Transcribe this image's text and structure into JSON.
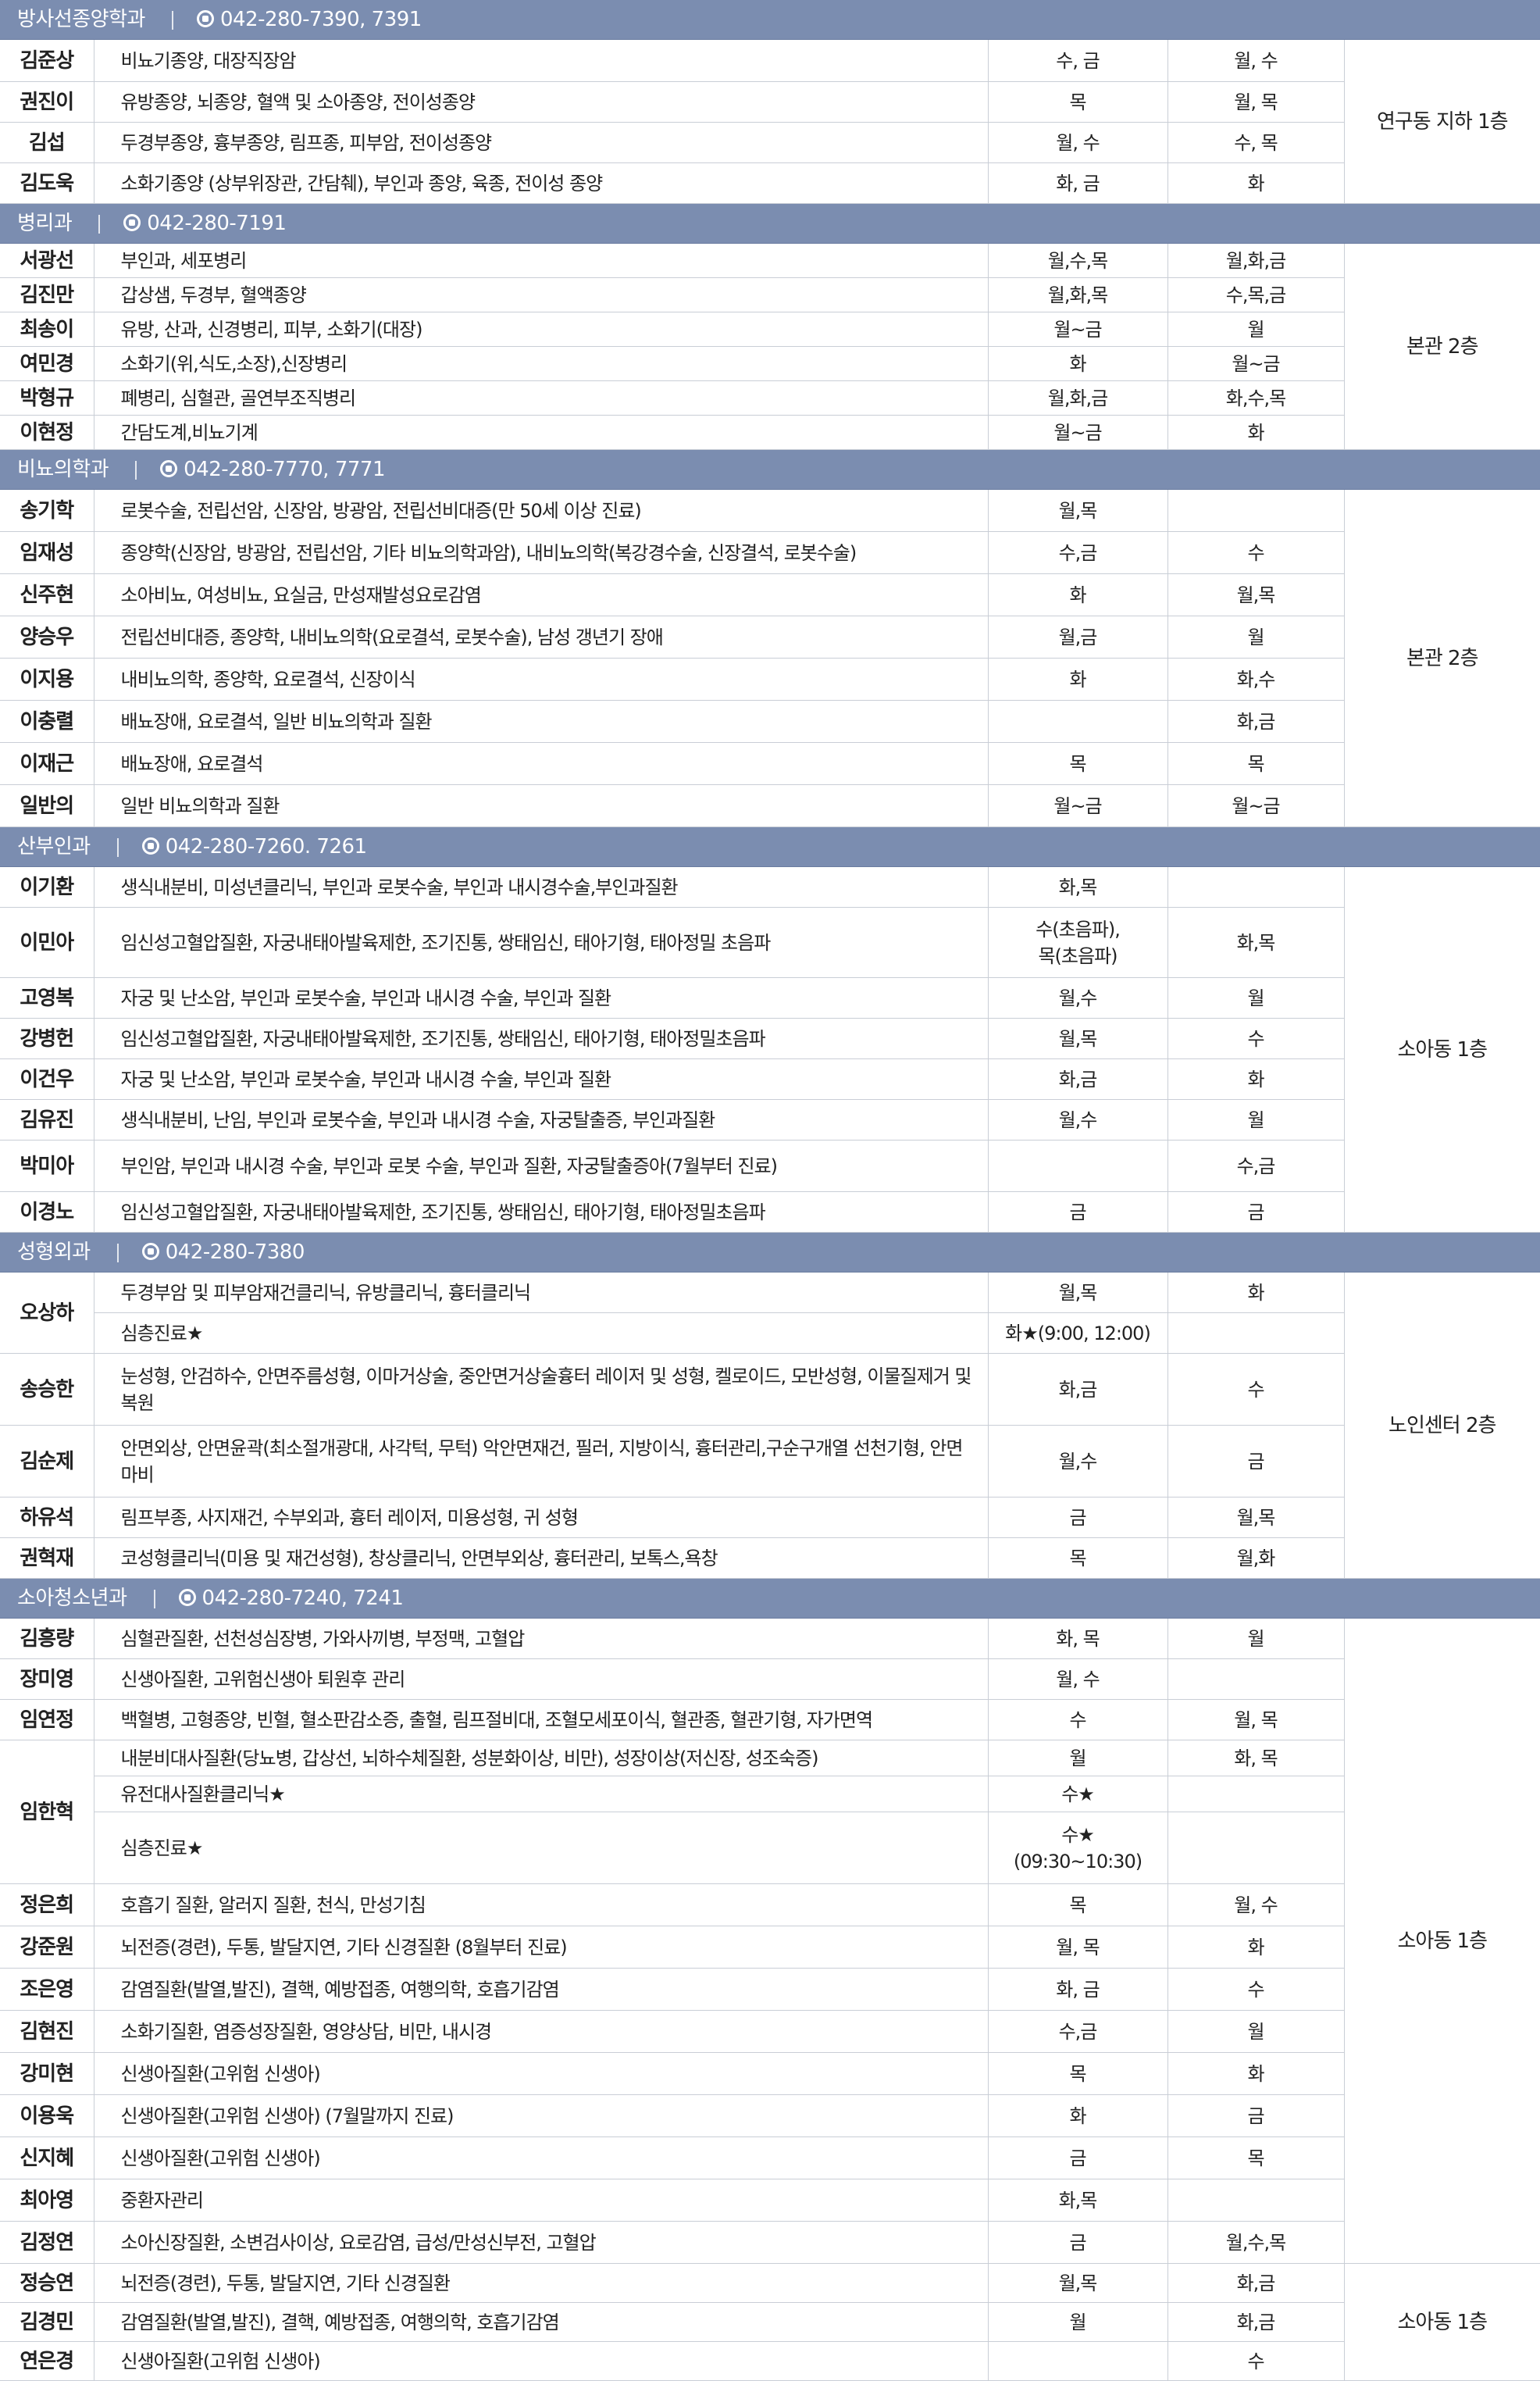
{
  "departments": [
    {
      "name": "방사선종양학과",
      "phone": "042-280-7390, 7391",
      "location": "연구동 지하 1층",
      "rows": [
        {
          "name": "김준상",
          "spec": "비뇨기종양, 대장직장암",
          "am": "수, 금",
          "pm": "월, 수"
        },
        {
          "name": "권진이",
          "spec": "유방종양, 뇌종양, 혈액 및 소아종양, 전이성종양",
          "am": "목",
          "pm": "월, 목"
        },
        {
          "name": "김섭",
          "spec": "두경부종양, 흉부종양, 림프종, 피부암, 전이성종양",
          "am": "월, 수",
          "pm": "수, 목"
        },
        {
          "name": "김도욱",
          "spec": "소화기종양 (상부위장관, 간담췌), 부인과 종양, 육종, 전이성 종양",
          "am": "화, 금",
          "pm": "화"
        }
      ]
    },
    {
      "name": "병리과",
      "phone": "042-280-7191",
      "location": "본관 2층",
      "rows": [
        {
          "name": "서광선",
          "spec": "부인과, 세포병리",
          "am": "월,수,목",
          "pm": "월,화,금"
        },
        {
          "name": "김진만",
          "spec": "갑상샘, 두경부, 혈액종양",
          "am": "월,화,목",
          "pm": "수,목,금"
        },
        {
          "name": "최송이",
          "spec": "유방, 산과, 신경병리, 피부, 소화기(대장)",
          "am": "월~금",
          "pm": "월"
        },
        {
          "name": "여민경",
          "spec": "소화기(위,식도,소장),신장병리",
          "am": "화",
          "pm": "월~금"
        },
        {
          "name": "박형규",
          "spec": "폐병리, 심혈관, 골연부조직병리",
          "am": "월,화,금",
          "pm": "화,수,목"
        },
        {
          "name": "이현정",
          "spec": "간담도계,비뇨기계",
          "am": "월~금",
          "pm": "화"
        }
      ]
    },
    {
      "name": "비뇨의학과",
      "phone": "042-280-7770, 7771",
      "location": "본관 2층",
      "rows": [
        {
          "name": "송기학",
          "spec": "로봇수술, 전립선암, 신장암, 방광암, 전립선비대증(만 50세 이상 진료)",
          "am": "월,목",
          "pm": ""
        },
        {
          "name": "임재성",
          "spec": "종양학(신장암, 방광암, 전립선암, 기타 비뇨의학과암), 내비뇨의학(복강경수술, 신장결석, 로봇수술)",
          "am": "수,금",
          "pm": "수"
        },
        {
          "name": "신주현",
          "spec": "소아비뇨, 여성비뇨, 요실금, 만성재발성요로감염",
          "am": "화",
          "pm": "월,목"
        },
        {
          "name": "양승우",
          "spec": "전립선비대증, 종양학, 내비뇨의학(요로결석, 로봇수술), 남성 갱년기 장애",
          "am": "월,금",
          "pm": "월"
        },
        {
          "name": "이지용",
          "spec": "내비뇨의학, 종양학, 요로결석, 신장이식",
          "am": "화",
          "pm": "화,수"
        },
        {
          "name": "이충렬",
          "spec": "배뇨장애, 요로결석, 일반 비뇨의학과 질환",
          "am": "",
          "pm": "화,금"
        },
        {
          "name": "이재근",
          "spec": "배뇨장애, 요로결석",
          "am": "목",
          "pm": "목"
        },
        {
          "name": "일반의",
          "spec": "일반 비뇨의학과 질환",
          "am": "월~금",
          "pm": "월~금"
        }
      ]
    },
    {
      "name": "산부인과",
      "phone": "042-280-7260. 7261",
      "location": "소아동 1층",
      "rows": [
        {
          "name": "이기환",
          "spec": "생식내분비, 미성년클리닉, 부인과 로봇수술, 부인과 내시경수술,부인과질환",
          "am": "화,목",
          "pm": ""
        },
        {
          "name": "이민아",
          "spec": "임신성고혈압질환, 자궁내태아발육제한, 조기진통, 쌍태임신, 태아기형, 태아정밀 초음파",
          "am": "수(초음파),\n목(초음파)",
          "pm": "화,목"
        },
        {
          "name": "고영복",
          "spec": "자궁 및 난소암, 부인과 로봇수술, 부인과 내시경 수술, 부인과 질환",
          "am": "월,수",
          "pm": "월"
        },
        {
          "name": "강병헌",
          "spec": "임신성고혈압질환, 자궁내태아발육제한, 조기진통, 쌍태임신, 태아기형, 태아정밀초음파",
          "am": "월,목",
          "pm": "수"
        },
        {
          "name": "이건우",
          "spec": "자궁 및 난소암, 부인과 로봇수술, 부인과 내시경 수술, 부인과 질환",
          "am": "화,금",
          "pm": "화"
        },
        {
          "name": "김유진",
          "spec": "생식내분비, 난임, 부인과 로봇수술, 부인과 내시경 수술, 자궁탈출증, 부인과질환",
          "am": "월,수",
          "pm": "월"
        },
        {
          "name": "박미아",
          "spec": "부인암, 부인과 내시경 수술, 부인과 로봇 수술, 부인과 질환, 자궁탈출증아(7월부터 진료)",
          "am": "",
          "pm": "수,금"
        },
        {
          "name": "이경노",
          "spec": "임신성고혈압질환, 자궁내태아발육제한, 조기진통, 쌍태임신, 태아기형, 태아정밀초음파",
          "am": "금",
          "pm": "금"
        }
      ]
    },
    {
      "name": "성형외과",
      "phone": "042-280-7380",
      "location": "노인센터 2층",
      "rows": [
        {
          "name": "오상하",
          "spec": "두경부암 및 피부암재건클리닉, 유방클리닉, 흉터클리닉",
          "am": "월,목",
          "pm": "화",
          "nameRowspan": 2
        },
        {
          "spec": "심층진료★",
          "am": "화★(9:00, 12:00)",
          "pm": ""
        },
        {
          "name": "송승한",
          "spec": "눈성형, 안검하수, 안면주름성형, 이마거상술, 중안면거상술흉터 레이저 및 성형, 켈로이드, 모반성형, 이물질제거 및 복원",
          "am": "화,금",
          "pm": "수"
        },
        {
          "name": "김순제",
          "spec": "안면외상, 안면윤곽(최소절개광대, 사각턱, 무턱) 악안면재건, 필러, 지방이식, 흉터관리,구순구개열 선천기형, 안면마비",
          "am": "월,수",
          "pm": "금"
        },
        {
          "name": "하유석",
          "spec": "림프부종, 사지재건, 수부외과, 흉터 레이저, 미용성형, 귀 성형",
          "am": "금",
          "pm": "월,목"
        },
        {
          "name": "권혁재",
          "spec": "코성형클리닉(미용 및 재건성형), 창상클리닉, 안면부외상, 흉터관리, 보톡스,욕창",
          "am": "목",
          "pm": "월,화"
        }
      ]
    },
    {
      "name": "소아청소년과",
      "phone": "042-280-7240, 7241",
      "location": "소아동 1층",
      "location2": "소아동 1층",
      "rows": [
        {
          "name": "김흥량",
          "spec": "심혈관질환, 선천성심장병, 가와사끼병, 부정맥, 고혈압",
          "am": "화, 목",
          "pm": "월"
        },
        {
          "name": "장미영",
          "spec": "신생아질환, 고위험신생아 퇴원후 관리",
          "am": "월, 수",
          "pm": ""
        },
        {
          "name": "임연정",
          "spec": "백혈병, 고형종양, 빈혈, 혈소판감소증, 출혈, 림프절비대, 조혈모세포이식, 혈관종, 혈관기형, 자가면역",
          "am": "수",
          "pm": "월, 목"
        },
        {
          "name": "임한혁",
          "spec": "내분비대사질환(당뇨병, 갑상선, 뇌하수체질환, 성분화이상, 비만), 성장이상(저신장, 성조숙증)",
          "am": "월",
          "pm": "화, 목",
          "nameRowspan": 3
        },
        {
          "spec": "유전대사질환클리닉★",
          "am": "수★",
          "pm": ""
        },
        {
          "spec": "심층진료★",
          "am": "수★\n(09:30~10:30)",
          "pm": ""
        },
        {
          "name": "정은희",
          "spec": "호흡기 질환, 알러지 질환, 천식, 만성기침",
          "am": "목",
          "pm": "월, 수"
        },
        {
          "name": "강준원",
          "spec": "뇌전증(경련), 두통, 발달지연, 기타 신경질환 (8월부터 진료)",
          "am": "월, 목",
          "pm": "화"
        },
        {
          "name": "조은영",
          "spec": "감염질환(발열,발진), 결핵, 예방접종, 여행의학, 호흡기감염",
          "am": "화, 금",
          "pm": "수"
        },
        {
          "name": "김현진",
          "spec": "소화기질환, 염증성장질환, 영양상담, 비만, 내시경",
          "am": "수,금",
          "pm": "월"
        },
        {
          "name": "강미현",
          "spec": "신생아질환(고위험 신생아)",
          "am": "목",
          "pm": "화"
        },
        {
          "name": "이용욱",
          "spec": "신생아질환(고위험 신생아) (7월말까지 진료)",
          "am": "화",
          "pm": "금"
        },
        {
          "name": "신지혜",
          "spec": "신생아질환(고위험 신생아)",
          "am": "금",
          "pm": "목"
        },
        {
          "name": "최아영",
          "spec": "중환자관리",
          "am": "화,목",
          "pm": ""
        },
        {
          "name": "김정연",
          "spec": "소아신장질환, 소변검사이상, 요로감염, 급성/만성신부전, 고혈압",
          "am": "금",
          "pm": "월,수,목"
        },
        {
          "name": "정승연",
          "spec": "뇌전증(경련), 두통, 발달지연, 기타 신경질환",
          "am": "월,목",
          "pm": "화,금"
        },
        {
          "name": "김경민",
          "spec": "감염질환(발열,발진), 결핵, 예방접종, 여행의학, 호흡기감염",
          "am": "월",
          "pm": "화,금"
        },
        {
          "name": "연은경",
          "spec": "신생아질환(고위험 신생아)",
          "am": "",
          "pm": "수"
        }
      ]
    }
  ],
  "colors": {
    "header_bg": "#7b8db0",
    "header_text": "#ffffff",
    "grid_line": "#c9ced6"
  },
  "icons": {
    "phone": "phone-icon"
  }
}
